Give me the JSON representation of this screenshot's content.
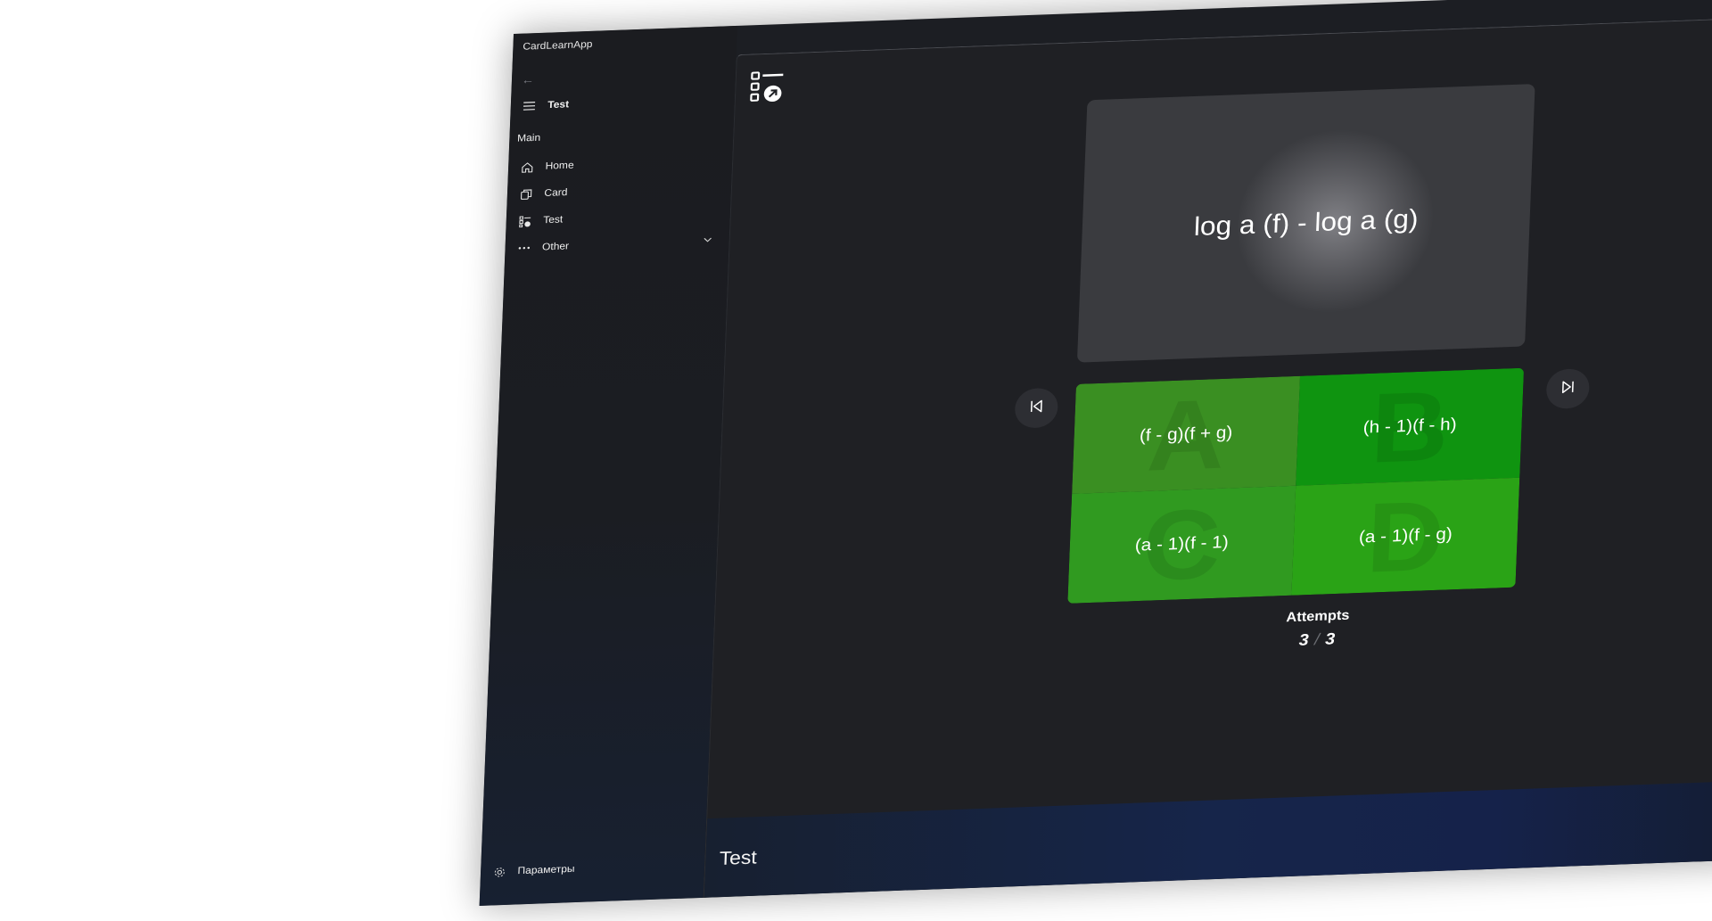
{
  "app": {
    "title": "CardLearnApp"
  },
  "sidebar": {
    "back_icon": "arrow-left-icon",
    "header": {
      "icon": "hamburger-icon",
      "label": "Test"
    },
    "section_label": "Main",
    "items": [
      {
        "label": "Home",
        "icon": "home-icon"
      },
      {
        "label": "Card",
        "icon": "cards-icon"
      },
      {
        "label": "Test",
        "icon": "test-list-icon"
      },
      {
        "label": "Other",
        "icon": "more-icon",
        "expand_icon": "chevron-down-icon"
      }
    ],
    "settings": {
      "label": "Параметры",
      "icon": "gear-icon"
    }
  },
  "main": {
    "question": "log a (f) - log a (g)",
    "prev_icon": "skip-previous-icon",
    "next_icon": "skip-next-icon",
    "answers": [
      {
        "letter": "A",
        "text": "(f - g)(f + g)",
        "color": "#3a8f22"
      },
      {
        "letter": "B",
        "text": "(h - 1)(f - h)",
        "color": "#0f9410"
      },
      {
        "letter": "C",
        "text": "(a - 1)(f - 1)",
        "color": "#309a20"
      },
      {
        "letter": "D",
        "text": "(a - 1)(f - g)",
        "color": "#2aa316"
      }
    ],
    "attempts": {
      "label": "Attempts",
      "current": "3",
      "separator": "/",
      "total": "3"
    }
  },
  "footer": {
    "title": "Test"
  },
  "colors": {
    "background": "#1f2024",
    "sidebar": "#1b1c20",
    "accent_green": "#0f9410"
  }
}
